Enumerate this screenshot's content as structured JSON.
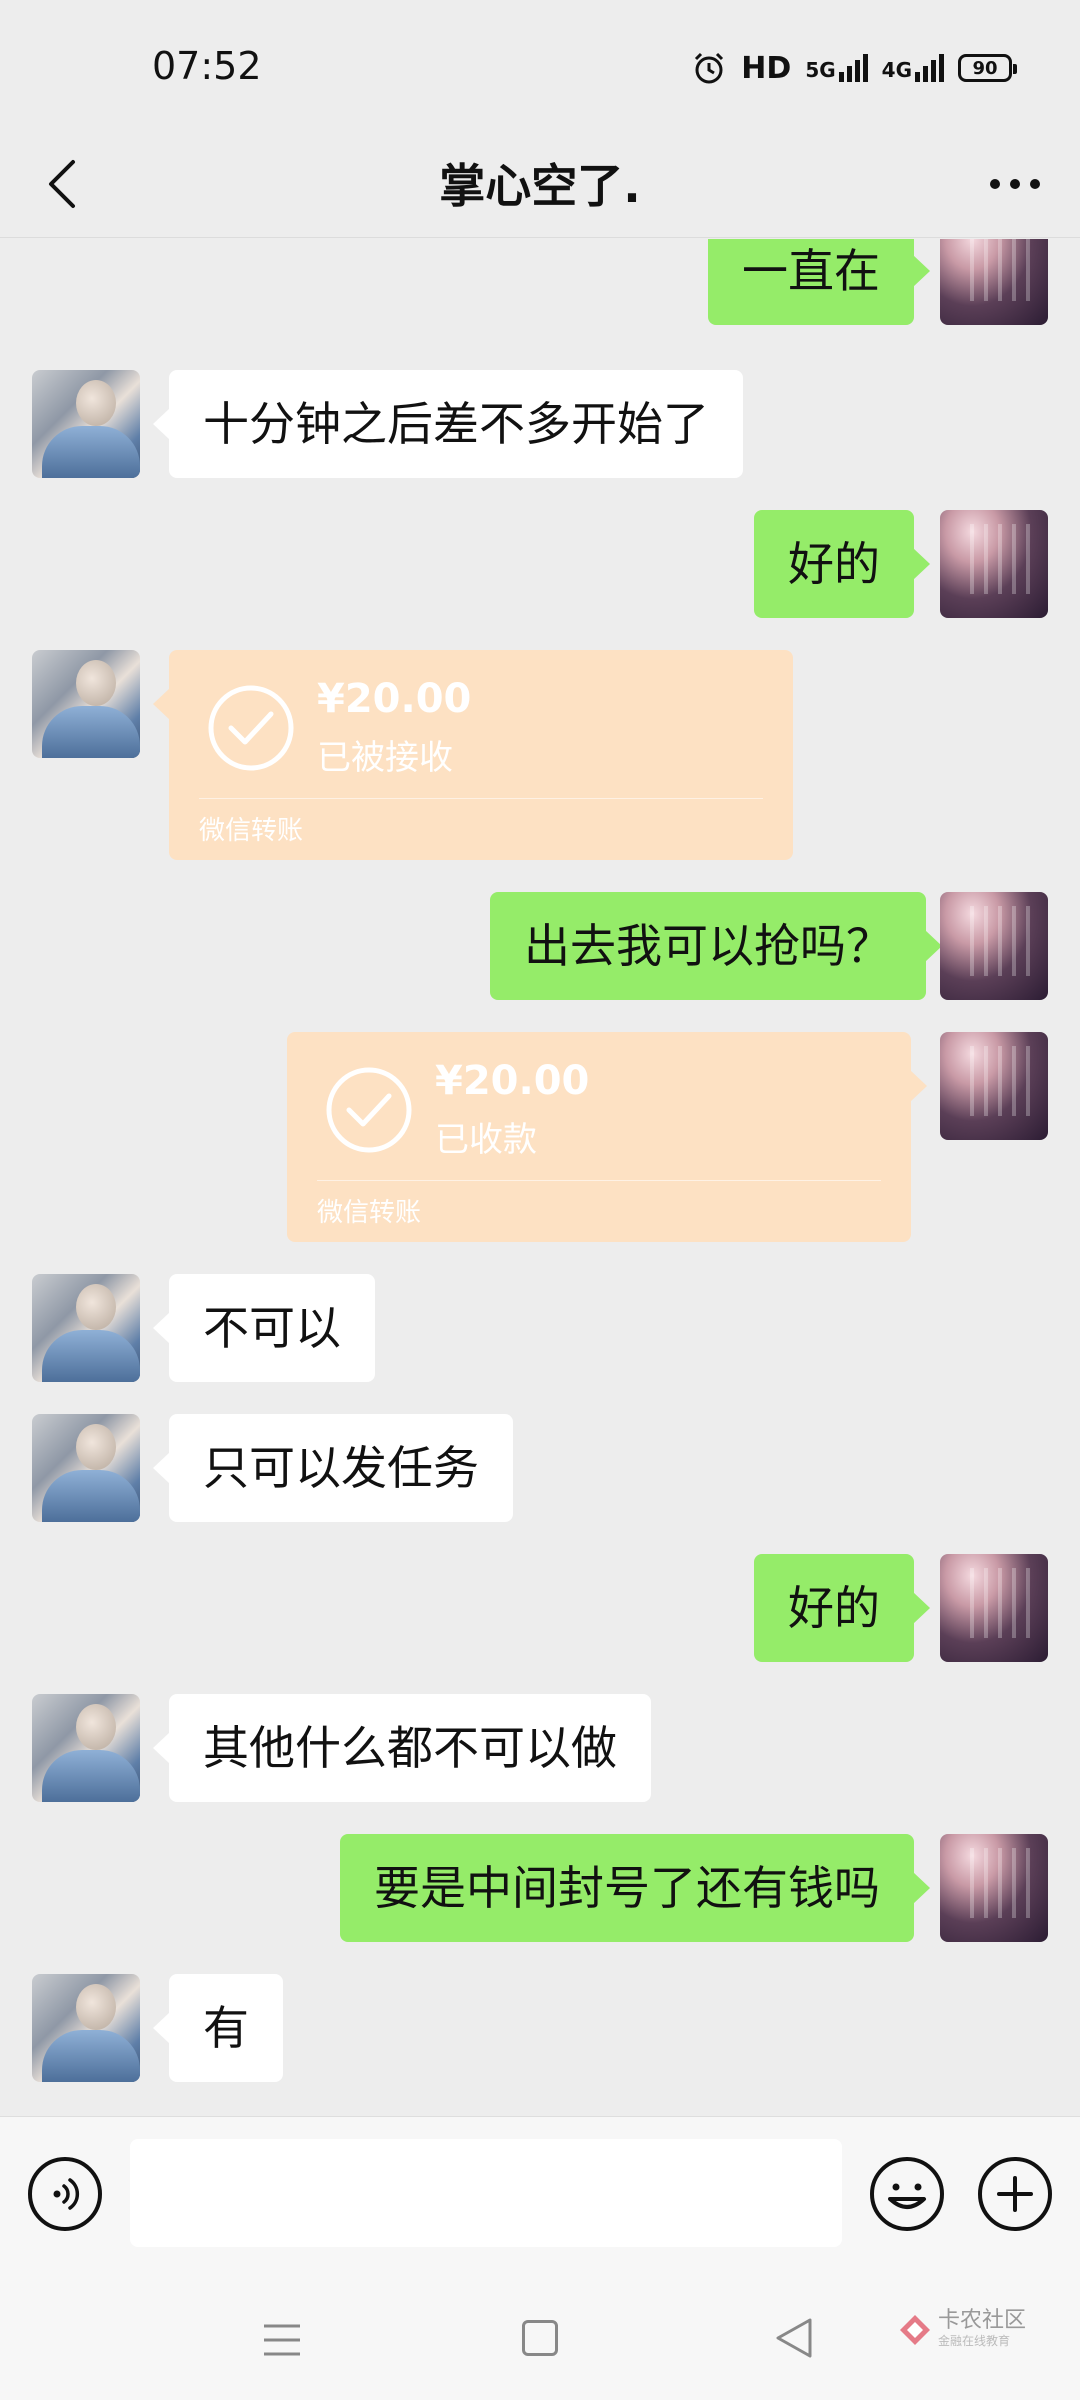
{
  "status_bar": {
    "time": "07:52",
    "network_hd": "HD",
    "network_5g": "5G",
    "network_4g": "4G",
    "battery": "90"
  },
  "header": {
    "title": "掌心空了."
  },
  "messages": [
    {
      "side": "out",
      "type": "text",
      "text": "一直在"
    },
    {
      "side": "in",
      "type": "text",
      "text": "十分钟之后差不多开始了"
    },
    {
      "side": "out",
      "type": "text",
      "text": "好的"
    },
    {
      "side": "in",
      "type": "transfer",
      "amount": "¥20.00",
      "status": "已被接收",
      "label": "微信转账"
    },
    {
      "side": "out",
      "type": "text",
      "text": "出去我可以抢吗？"
    },
    {
      "side": "out",
      "type": "transfer",
      "amount": "¥20.00",
      "status": "已收款",
      "label": "微信转账"
    },
    {
      "side": "in",
      "type": "text",
      "text": "不可以"
    },
    {
      "side": "in",
      "type": "text",
      "text": "只可以发任务"
    },
    {
      "side": "out",
      "type": "text",
      "text": "好的"
    },
    {
      "side": "in",
      "type": "text",
      "text": "其他什么都不可以做"
    },
    {
      "side": "out",
      "type": "text",
      "text": "要是中间封号了还有钱吗"
    },
    {
      "side": "in",
      "type": "text",
      "text": "有"
    }
  ],
  "input": {
    "value": "",
    "placeholder": ""
  },
  "watermark": {
    "text": "卡农社区",
    "subtext": "金融在线教育"
  },
  "colors": {
    "background": "#ededed",
    "bubble_out": "#95ec69",
    "bubble_in": "#ffffff",
    "transfer_card": "#fde1c3"
  }
}
